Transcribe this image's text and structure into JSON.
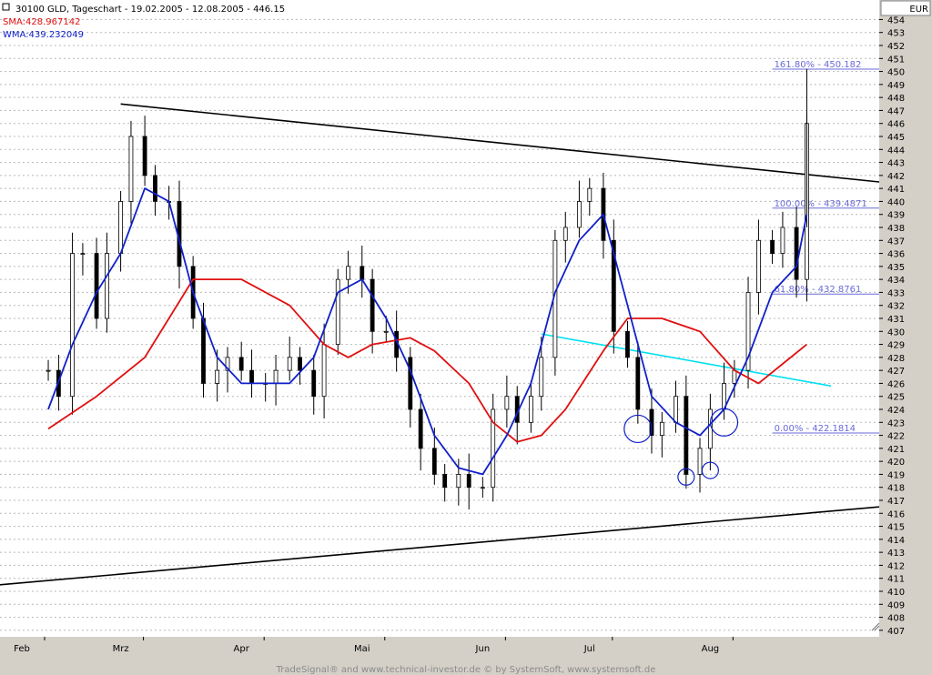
{
  "header": {
    "title": "30100  GLD, Tageschart - 19.02.2005 - 12.08.2005 - 446.15",
    "sma_label": "SMA:428.967142",
    "wma_label": "WMA:439.232049"
  },
  "currency": "EUR",
  "footer": "TradeSignal® and www.technical-investor.de © by  SystemSoft, www.systemsoft.de",
  "colors": {
    "sma": "#e01010",
    "wma": "#1020c8",
    "fib": "#6a6ad8",
    "neckline": "#00e0f0",
    "trend": "#000000",
    "grid": "#b8b8b8",
    "panel": "#d4d0c8"
  },
  "chart_data": {
    "type": "line",
    "instrument": "30100 GLD",
    "ylim": [
      406.5,
      455.5
    ],
    "y_ticks": [
      407,
      408,
      409,
      410,
      411,
      412,
      413,
      414,
      415,
      416,
      417,
      418,
      419,
      420,
      421,
      422,
      423,
      424,
      425,
      426,
      427,
      428,
      429,
      430,
      431,
      432,
      433,
      434,
      435,
      436,
      437,
      438,
      439,
      440,
      441,
      442,
      443,
      444,
      445,
      446,
      447,
      448,
      449,
      450,
      451,
      452,
      453,
      454
    ],
    "x_ticks": [
      "Feb",
      "Mrz",
      "Apr",
      "Mai",
      "Jun",
      "Jul",
      "Aug"
    ],
    "close_series": [
      {
        "date": "2005-02-21",
        "value": 427
      },
      {
        "date": "2005-02-24",
        "value": 425
      },
      {
        "date": "2005-02-28",
        "value": 436
      },
      {
        "date": "2005-03-03",
        "value": 436
      },
      {
        "date": "2005-03-07",
        "value": 431
      },
      {
        "date": "2005-03-10",
        "value": 436
      },
      {
        "date": "2005-03-14",
        "value": 440
      },
      {
        "date": "2005-03-17",
        "value": 445
      },
      {
        "date": "2005-03-21",
        "value": 442
      },
      {
        "date": "2005-03-24",
        "value": 440
      },
      {
        "date": "2005-03-28",
        "value": 440
      },
      {
        "date": "2005-03-31",
        "value": 435
      },
      {
        "date": "2005-04-04",
        "value": 431
      },
      {
        "date": "2005-04-07",
        "value": 426
      },
      {
        "date": "2005-04-11",
        "value": 427
      },
      {
        "date": "2005-04-14",
        "value": 428
      },
      {
        "date": "2005-04-18",
        "value": 427
      },
      {
        "date": "2005-04-21",
        "value": 426
      },
      {
        "date": "2005-04-25",
        "value": 426
      },
      {
        "date": "2005-04-28",
        "value": 427
      },
      {
        "date": "2005-05-02",
        "value": 428
      },
      {
        "date": "2005-05-05",
        "value": 427
      },
      {
        "date": "2005-05-09",
        "value": 425
      },
      {
        "date": "2005-05-12",
        "value": 429
      },
      {
        "date": "2005-05-16",
        "value": 434
      },
      {
        "date": "2005-05-19",
        "value": 435
      },
      {
        "date": "2005-05-23",
        "value": 434
      },
      {
        "date": "2005-05-26",
        "value": 430
      },
      {
        "date": "2005-05-30",
        "value": 430
      },
      {
        "date": "2005-06-02",
        "value": 428
      },
      {
        "date": "2005-06-06",
        "value": 424
      },
      {
        "date": "2005-06-09",
        "value": 421
      },
      {
        "date": "2005-06-13",
        "value": 419
      },
      {
        "date": "2005-06-16",
        "value": 418
      },
      {
        "date": "2005-06-20",
        "value": 419
      },
      {
        "date": "2005-06-23",
        "value": 418
      },
      {
        "date": "2005-06-27",
        "value": 418
      },
      {
        "date": "2005-06-30",
        "value": 424
      },
      {
        "date": "2005-07-04",
        "value": 425
      },
      {
        "date": "2005-07-07",
        "value": 423
      },
      {
        "date": "2005-07-11",
        "value": 425
      },
      {
        "date": "2005-07-14",
        "value": 428
      },
      {
        "date": "2005-07-18",
        "value": 437
      },
      {
        "date": "2005-07-21",
        "value": 438
      },
      {
        "date": "2005-07-25",
        "value": 440
      },
      {
        "date": "2005-07-28",
        "value": 441
      },
      {
        "date": "2005-08-01",
        "value": 437
      },
      {
        "date": "2005-08-04",
        "value": 430
      },
      {
        "date": "2005-08-08",
        "value": 428
      },
      {
        "date": "2005-08-11",
        "value": 424
      },
      {
        "date": "2005-08-15",
        "value": 422
      },
      {
        "date": "2005-08-18",
        "value": 423
      },
      {
        "date": "2005-08-22",
        "value": 425
      },
      {
        "date": "2005-08-25",
        "value": 419
      },
      {
        "date": "2005-08-29",
        "value": 421
      },
      {
        "date": "2005-09-01",
        "value": 424
      },
      {
        "date": "2005-09-05",
        "value": 426
      },
      {
        "date": "2005-09-08",
        "value": 427
      },
      {
        "date": "2005-09-12",
        "value": 433
      },
      {
        "date": "2005-09-15",
        "value": 437
      },
      {
        "date": "2005-09-19",
        "value": 436
      },
      {
        "date": "2005-09-22",
        "value": 438
      },
      {
        "date": "2005-09-26",
        "value": 434
      },
      {
        "date": "2005-09-29",
        "value": 446
      }
    ],
    "wma_series": [
      {
        "date": "2005-02-21",
        "value": 424
      },
      {
        "date": "2005-02-28",
        "value": 429
      },
      {
        "date": "2005-03-07",
        "value": 433
      },
      {
        "date": "2005-03-14",
        "value": 436
      },
      {
        "date": "2005-03-21",
        "value": 441
      },
      {
        "date": "2005-03-28",
        "value": 440
      },
      {
        "date": "2005-04-04",
        "value": 433
      },
      {
        "date": "2005-04-11",
        "value": 428
      },
      {
        "date": "2005-04-18",
        "value": 426
      },
      {
        "date": "2005-04-25",
        "value": 426
      },
      {
        "date": "2005-05-02",
        "value": 426
      },
      {
        "date": "2005-05-09",
        "value": 428
      },
      {
        "date": "2005-05-16",
        "value": 433
      },
      {
        "date": "2005-05-23",
        "value": 434
      },
      {
        "date": "2005-05-30",
        "value": 431
      },
      {
        "date": "2005-06-06",
        "value": 427
      },
      {
        "date": "2005-06-13",
        "value": 422
      },
      {
        "date": "2005-06-20",
        "value": 419.5
      },
      {
        "date": "2005-06-27",
        "value": 419
      },
      {
        "date": "2005-07-04",
        "value": 422
      },
      {
        "date": "2005-07-11",
        "value": 426
      },
      {
        "date": "2005-07-18",
        "value": 433
      },
      {
        "date": "2005-07-25",
        "value": 437
      },
      {
        "date": "2005-08-01",
        "value": 439
      },
      {
        "date": "2005-08-08",
        "value": 432
      },
      {
        "date": "2005-08-15",
        "value": 425
      },
      {
        "date": "2005-08-22",
        "value": 423
      },
      {
        "date": "2005-08-29",
        "value": 422
      },
      {
        "date": "2005-09-05",
        "value": 424
      },
      {
        "date": "2005-09-12",
        "value": 428
      },
      {
        "date": "2005-09-19",
        "value": 433
      },
      {
        "date": "2005-09-26",
        "value": 435
      },
      {
        "date": "2005-09-29",
        "value": 439
      }
    ],
    "sma_series": [
      {
        "date": "2005-02-21",
        "value": 422.5
      },
      {
        "date": "2005-03-07",
        "value": 425
      },
      {
        "date": "2005-03-21",
        "value": 428
      },
      {
        "date": "2005-03-28",
        "value": 431
      },
      {
        "date": "2005-04-04",
        "value": 434
      },
      {
        "date": "2005-04-18",
        "value": 434
      },
      {
        "date": "2005-05-02",
        "value": 432
      },
      {
        "date": "2005-05-12",
        "value": 429
      },
      {
        "date": "2005-05-19",
        "value": 428
      },
      {
        "date": "2005-05-26",
        "value": 429
      },
      {
        "date": "2005-06-06",
        "value": 429.5
      },
      {
        "date": "2005-06-13",
        "value": 428.5
      },
      {
        "date": "2005-06-23",
        "value": 426
      },
      {
        "date": "2005-06-30",
        "value": 423
      },
      {
        "date": "2005-07-07",
        "value": 421.5
      },
      {
        "date": "2005-07-14",
        "value": 422
      },
      {
        "date": "2005-07-21",
        "value": 424
      },
      {
        "date": "2005-08-01",
        "value": 428.5
      },
      {
        "date": "2005-08-08",
        "value": 431
      },
      {
        "date": "2005-08-18",
        "value": 431
      },
      {
        "date": "2005-08-29",
        "value": 430
      },
      {
        "date": "2005-09-08",
        "value": 427
      },
      {
        "date": "2005-09-15",
        "value": 426
      },
      {
        "date": "2005-09-22",
        "value": 427.5
      },
      {
        "date": "2005-09-29",
        "value": 429
      }
    ],
    "fibonacci_levels": [
      {
        "label": "161.80% - 450.182",
        "value": 450.182
      },
      {
        "label": "100.00% - 439.4871",
        "value": 439.4871
      },
      {
        "label": "61.80% - 432.8761",
        "value": 432.8761
      },
      {
        "label": "0.00% - 422.1814",
        "value": 422.1814
      }
    ],
    "trendlines": [
      {
        "name": "upper",
        "from": {
          "date": "2005-03-14",
          "value": 447.5
        },
        "to": {
          "date": "2005-10-20",
          "value": 441.5
        }
      },
      {
        "name": "lower",
        "from": {
          "date": "2005-02-07",
          "value": 410.5
        },
        "to": {
          "date": "2005-10-20",
          "value": 416.5
        }
      },
      {
        "name": "neckline",
        "from": {
          "date": "2005-07-14",
          "value": 429.8
        },
        "to": {
          "date": "2005-10-06",
          "value": 425.8
        }
      }
    ],
    "circles": [
      {
        "date": "2005-08-11",
        "value": 422.5
      },
      {
        "date": "2005-08-25",
        "value": 418.8
      },
      {
        "date": "2005-09-01",
        "value": 419.3
      },
      {
        "date": "2005-09-05",
        "value": 423
      }
    ],
    "grid": true
  }
}
